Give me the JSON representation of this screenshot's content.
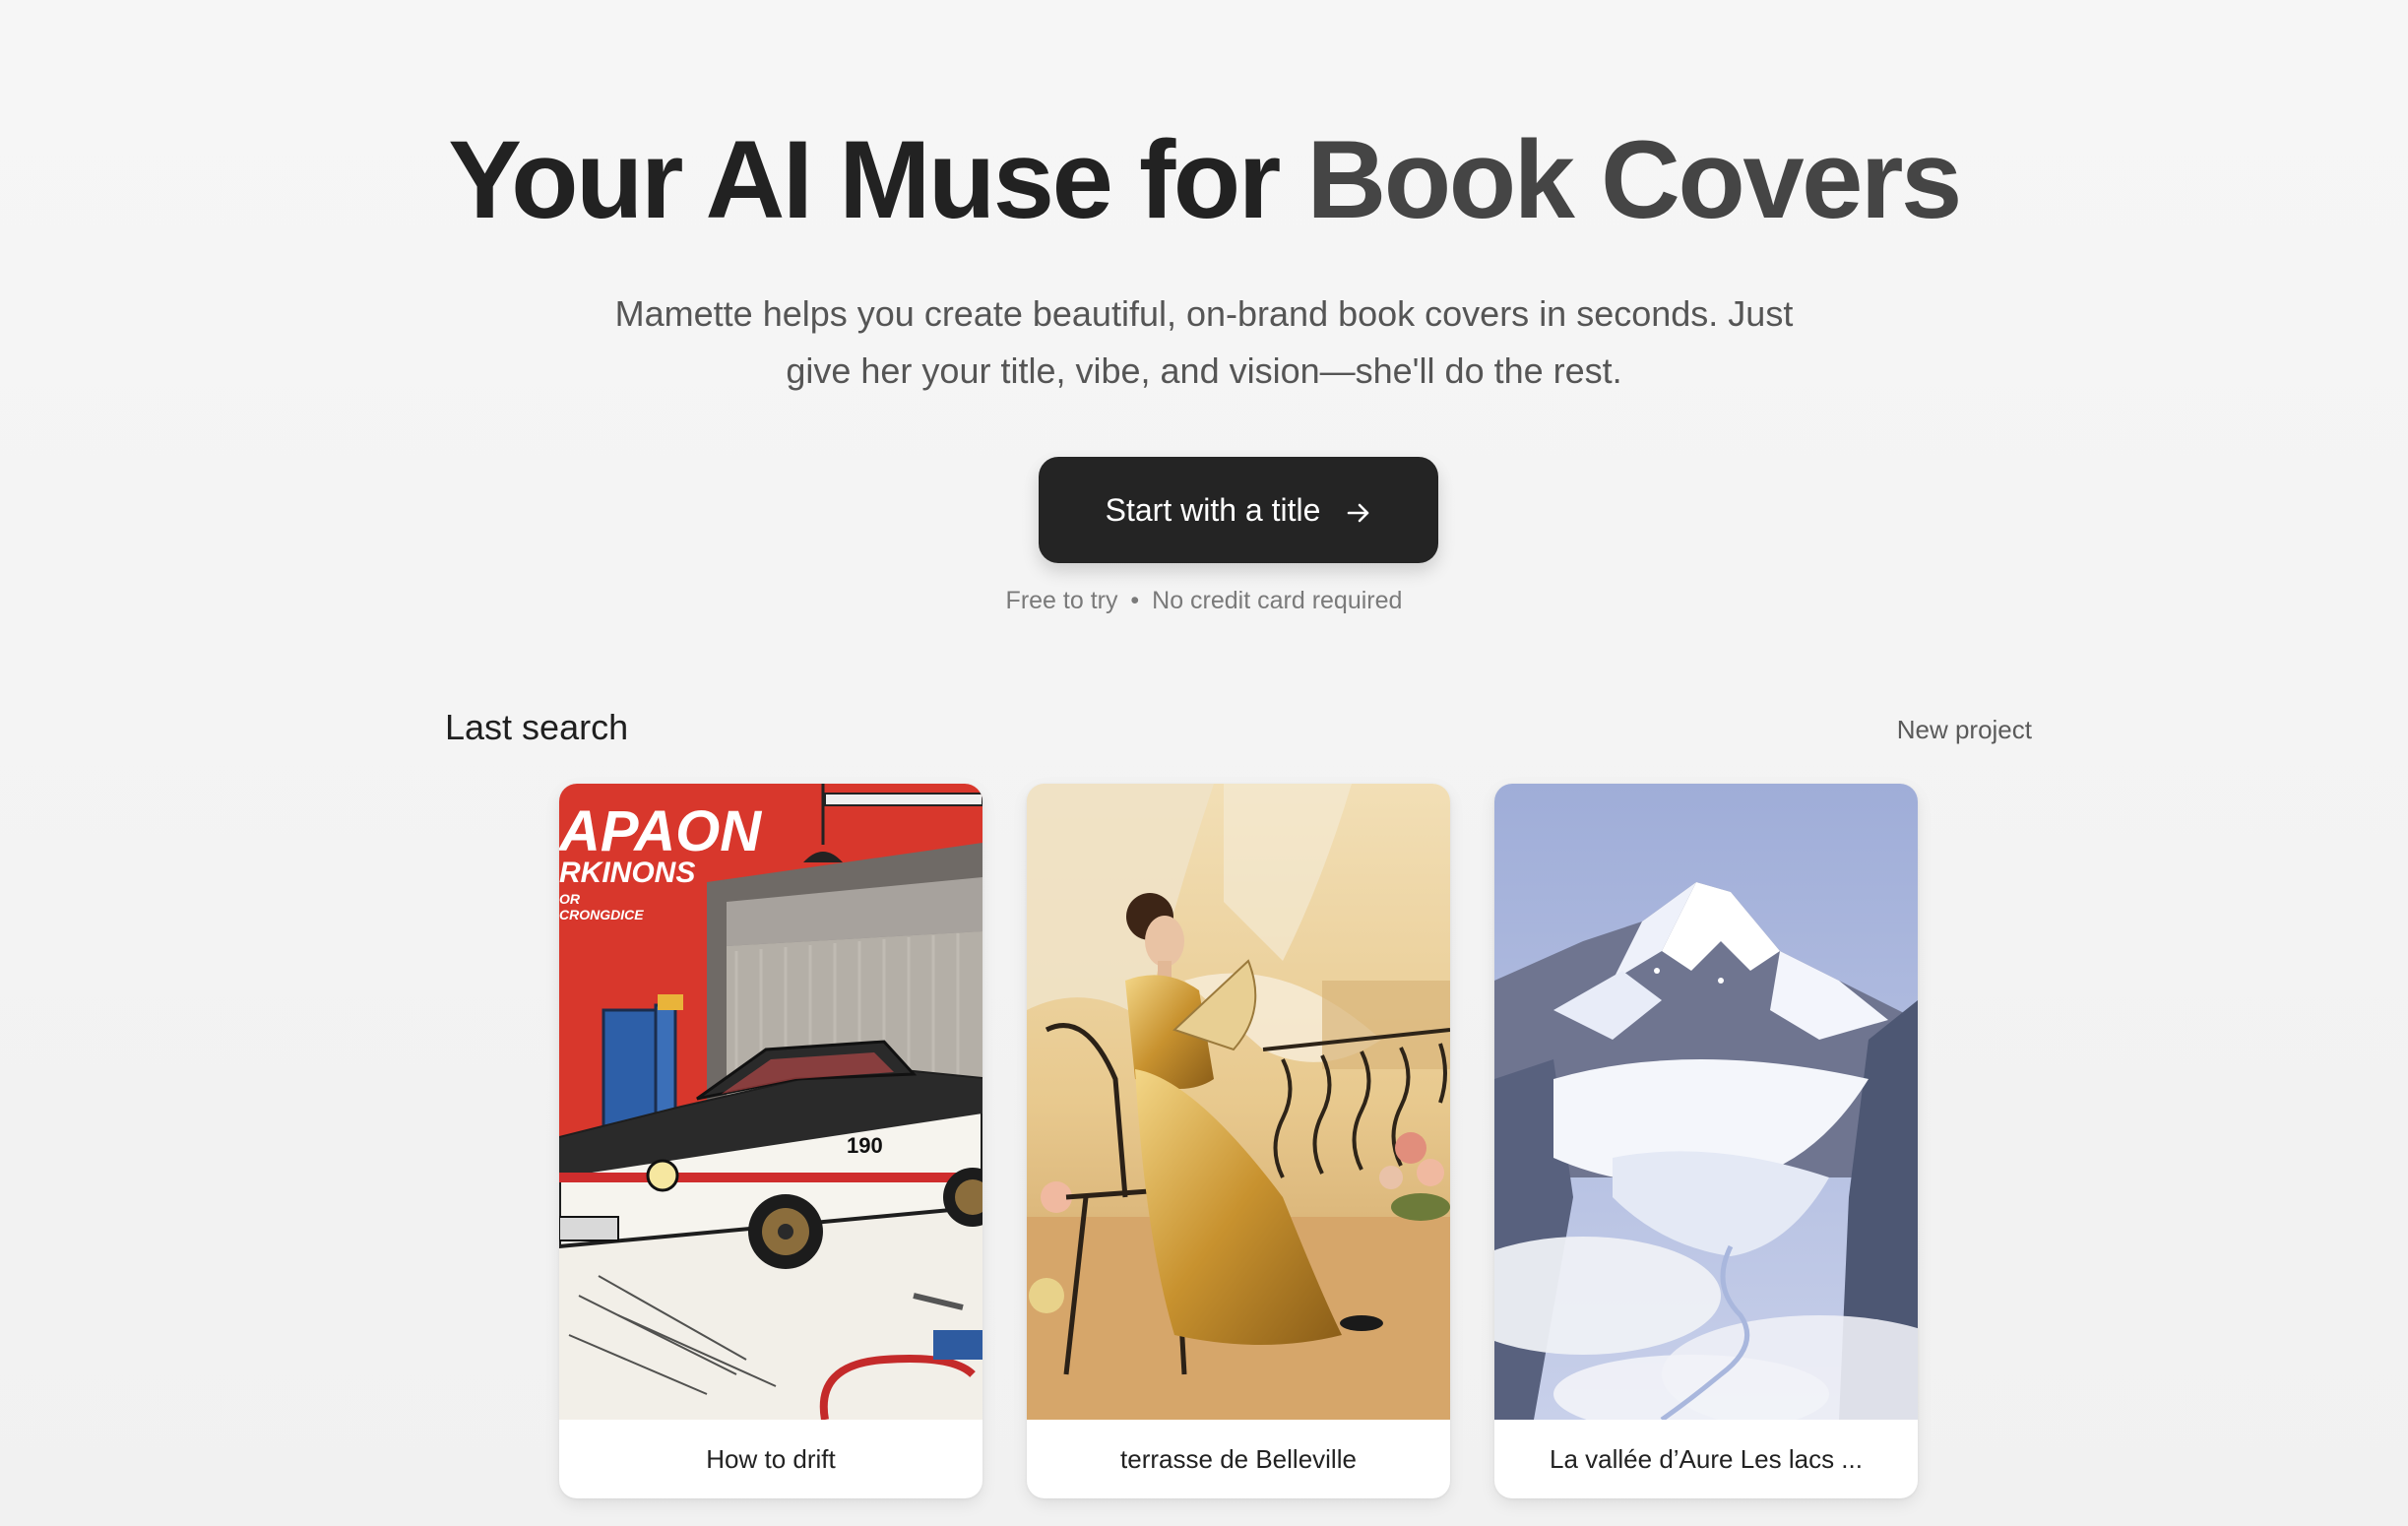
{
  "hero": {
    "headline_main": "Your AI Muse for ",
    "headline_accent": "Book Covers",
    "subtitle": "Mamette helps you create beautiful, on-brand book covers in seconds. Just give her your title, vibe, and vision—she'll do the rest.",
    "cta_label": "Start with a title",
    "cta_icon": "arrow-right-icon",
    "note_free": "Free to try",
    "note_separator": "•",
    "note_card": "No credit card required"
  },
  "last_search": {
    "title": "Last search",
    "new_project_label": "New project",
    "cards": [
      {
        "label": "How to drift",
        "art_text_line1": "APAON",
        "art_text_line2": "RKINONS",
        "art_text_line3": "OR",
        "art_text_line4": "CRONGDICE",
        "car_number": "190"
      },
      {
        "label": "terrasse de Belleville"
      },
      {
        "label": "La vallée d’Aure Les lacs ..."
      }
    ]
  },
  "colors": {
    "background": "#f4f4f4",
    "headline": "#222222",
    "headline_accent": "#454545",
    "cta_background": "#242424",
    "cta_text": "#ffffff",
    "muted_text": "#7a7a7a"
  }
}
